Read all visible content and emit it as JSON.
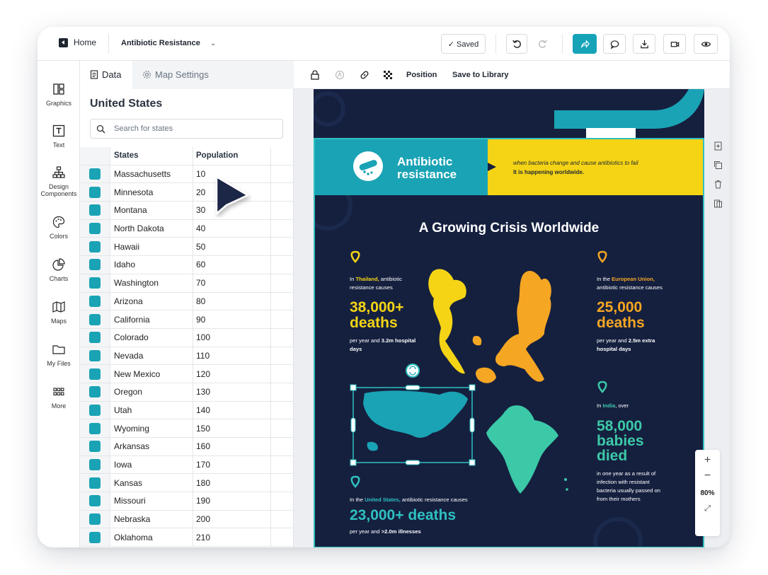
{
  "topbar": {
    "home_label": "Home",
    "doc_title": "Antibiotic Resistance",
    "saved_label": "✓ Saved",
    "colors": {
      "accent": "#16a3b8"
    }
  },
  "rail": {
    "items": [
      {
        "label": "Graphics",
        "icon": "graphics-icon"
      },
      {
        "label": "Text",
        "icon": "text-icon"
      },
      {
        "label": "Design Components",
        "icon": "components-icon"
      },
      {
        "label": "Colors",
        "icon": "palette-icon"
      },
      {
        "label": "Charts",
        "icon": "pie-chart-icon"
      },
      {
        "label": "Maps",
        "icon": "map-icon"
      },
      {
        "label": "My Files",
        "icon": "folder-icon"
      },
      {
        "label": "More",
        "icon": "more-grid-icon"
      }
    ]
  },
  "panel": {
    "tab_data": "Data",
    "tab_map_settings": "Map Settings",
    "title": "United States",
    "search_placeholder": "Search for states",
    "columns": [
      "States",
      "Population"
    ],
    "rows": [
      [
        "Massachusetts",
        "10"
      ],
      [
        "Minnesota",
        "20"
      ],
      [
        "Montana",
        "30"
      ],
      [
        "North Dakota",
        "40"
      ],
      [
        "Hawaii",
        "50"
      ],
      [
        "Idaho",
        "60"
      ],
      [
        "Washington",
        "70"
      ],
      [
        "Arizona",
        "80"
      ],
      [
        "California",
        "90"
      ],
      [
        "Colorado",
        "100"
      ],
      [
        "Nevada",
        "110"
      ],
      [
        "New Mexico",
        "120"
      ],
      [
        "Oregon",
        "130"
      ],
      [
        "Utah",
        "140"
      ],
      [
        "Wyoming",
        "150"
      ],
      [
        "Arkansas",
        "160"
      ],
      [
        "Iowa",
        "170"
      ],
      [
        "Kansas",
        "180"
      ],
      [
        "Missouri",
        "190"
      ],
      [
        "Nebraska",
        "200"
      ],
      [
        "Oklahoma",
        "210"
      ]
    ],
    "swatch_color": "#1aa3b5"
  },
  "canvas_toolbar": {
    "position_label": "Position",
    "save_library_label": "Save to Library"
  },
  "zoom": {
    "level": "80%"
  },
  "infographic": {
    "header_title_line1": "Antibiotic",
    "header_title_line2": "resistance",
    "header_sub1": "when bacteria change and cause antibiotics to fail",
    "header_sub2": "It is happening worldwide.",
    "main_title": "A Growing Crisis Worldwide",
    "thailand": {
      "pre": "In ",
      "place": "Thailand,",
      "post1": " antibiotic",
      "line2": "resistance causes",
      "big1": "38,000+",
      "big2": "deaths",
      "note1": "per year and ",
      "note_b": "3.2m hospital",
      "note2": "days"
    },
    "eu": {
      "pre": "In the ",
      "place": "European Union,",
      "line2": "antibiotic resistance causes",
      "big1": "25,000",
      "big2": "deaths",
      "note1": "per year and ",
      "note_b": "2.5m extra",
      "note2": "hospital days"
    },
    "india": {
      "pre": "In ",
      "place": "India",
      "post": ", over",
      "big1": "58,000",
      "big2": "babies",
      "big3": "died",
      "note": [
        "in one year as a result of",
        "infection  with resistant",
        "bacteria usually passed on",
        "from their mothers"
      ]
    },
    "us": {
      "pre": "In the ",
      "place": "United States,",
      "post": " antibiotic resistance causes",
      "big": "23,000+ deaths",
      "note1": "per year and ",
      "note_b": ">2.0m illnesses"
    },
    "colors": {
      "navy": "#15203f",
      "teal_band": "#1aa3b5",
      "yellow": "#f5d415",
      "orange": "#f5a623",
      "india_green": "#3cc9a8"
    }
  }
}
